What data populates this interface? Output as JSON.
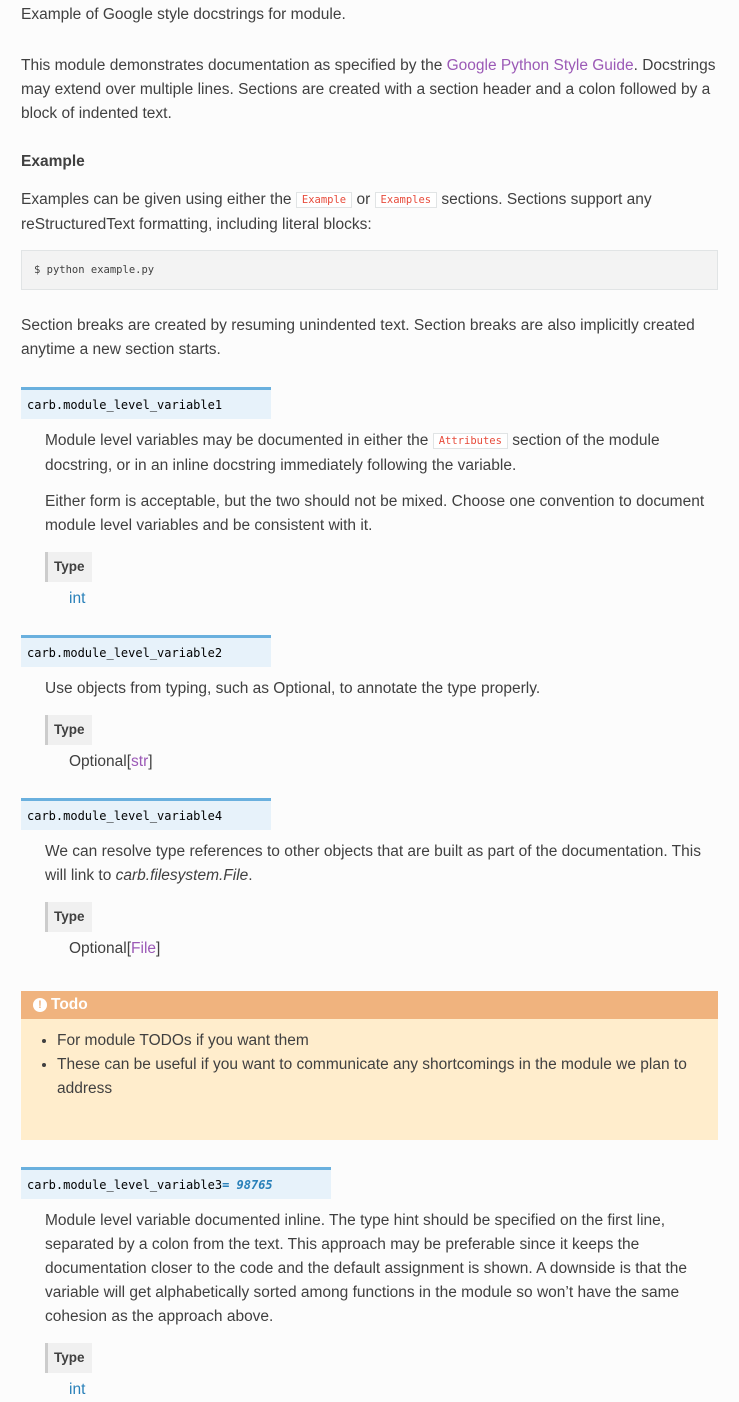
{
  "intro": {
    "summary": "Example of Google style docstrings for module.",
    "para_before_link": "This module demonstrates documentation as specified by the ",
    "link_text": "Google Python Style Guide",
    "para_after_link": ". Docstrings may extend over multiple lines. Sections are created with a section header and a colon followed by a block of indented text."
  },
  "example_section": {
    "heading": "Example",
    "text_before": "Examples can be given using either the ",
    "code1": "Example",
    "text_mid": " or ",
    "code2": "Examples",
    "text_after": " sections. Sections support any reStructuredText formatting, including literal blocks:",
    "code_block": "$ python example.py",
    "after_code": "Section breaks are created by resuming unindented text. Section breaks are also implicitly created anytime a new section starts."
  },
  "type_label": "Type",
  "variables": [
    {
      "signature": "carb.module_level_variable1",
      "para1_before": "Module level variables may be documented in either the ",
      "para1_code": "Attributes",
      "para1_after": " section of the module docstring, or in an inline docstring immediately following the variable.",
      "para2": "Either form is acceptable, but the two should not be mixed. Choose one convention to document module level variables and be consistent with it.",
      "type": "int"
    },
    {
      "signature": "carb.module_level_variable2",
      "para1": "Use objects from typing, such as Optional, to annotate the type properly.",
      "type_prefix": "Optional[",
      "type_ref": "str",
      "type_suffix": "]"
    },
    {
      "signature": "carb.module_level_variable4",
      "para1_before": "We can resolve type references to other objects that are built as part of the documentation. This will link to ",
      "para1_em": "carb.filesystem.File",
      "para1_after": ".",
      "type_prefix": "Optional[",
      "type_ref": "File",
      "type_suffix": "]"
    },
    {
      "signature": "carb.module_level_variable3",
      "default": "= 98765",
      "para1": "Module level variable documented inline. The type hint should be specified on the first line, separated by a colon from the text. This approach may be preferable since it keeps the documentation closer to the code and the default assignment is shown. A downside is that the variable will get alphabetically sorted among functions in the module so won’t have the same cohesion as the approach above.",
      "type": "int"
    }
  ],
  "todo": {
    "icon": "exclamation-circle-icon",
    "title": "Todo",
    "items": [
      "For module TODOs if you want them",
      "These can be useful if you want to communicate any shortcomings in the module we plan to address"
    ]
  },
  "colors": {
    "link": "#9b59b6",
    "type_link": "#2980b9",
    "code_text": "#e74c3c",
    "sig_bg": "#e7f2fa",
    "sig_border": "#6ab0de",
    "todo_header": "#f0b37e",
    "todo_bg": "#ffedcc"
  }
}
